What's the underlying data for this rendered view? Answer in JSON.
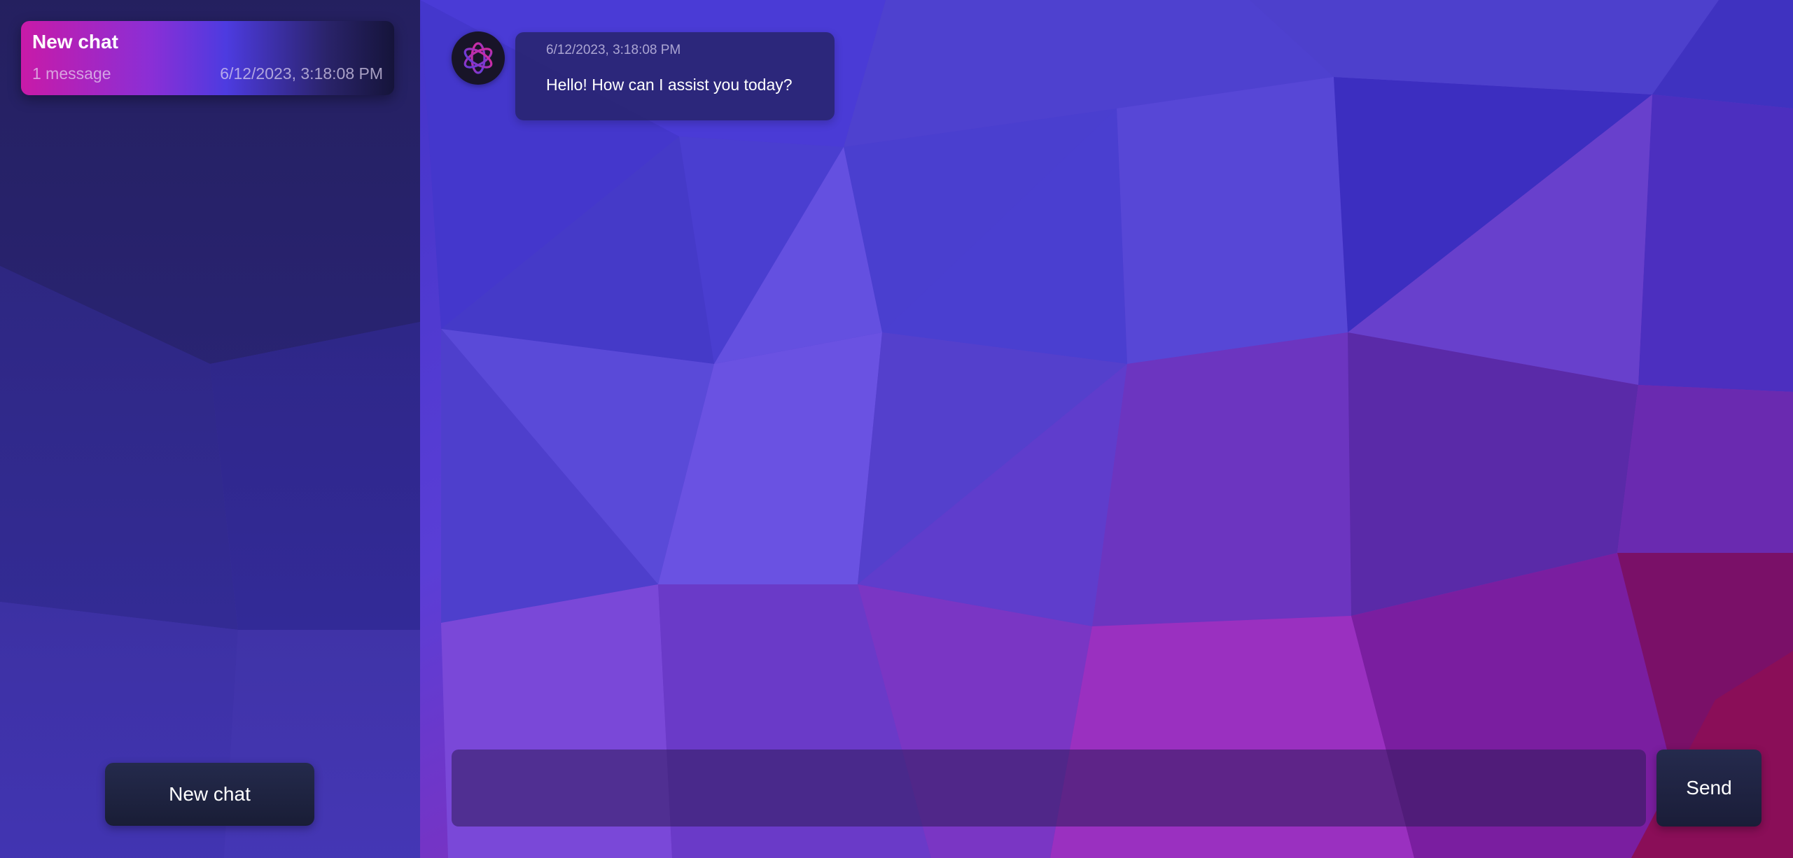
{
  "sidebar": {
    "chats": [
      {
        "title": "New chat",
        "message_count": "1 message",
        "timestamp": "6/12/2023, 3:18:08 PM"
      }
    ],
    "new_chat_label": "New chat"
  },
  "conversation": {
    "messages": [
      {
        "sender_icon": "openai-logo-icon",
        "timestamp": "6/12/2023, 3:18:08 PM",
        "text": "Hello! How can I assist you today?"
      }
    ]
  },
  "composer": {
    "input_value": "",
    "send_label": "Send"
  },
  "colors": {
    "accent_pink": "#c81aa8",
    "accent_purple": "#4d3be0",
    "button_dark": "#1a1d38"
  },
  "background": {
    "style": "low-poly gradient purple to magenta"
  }
}
